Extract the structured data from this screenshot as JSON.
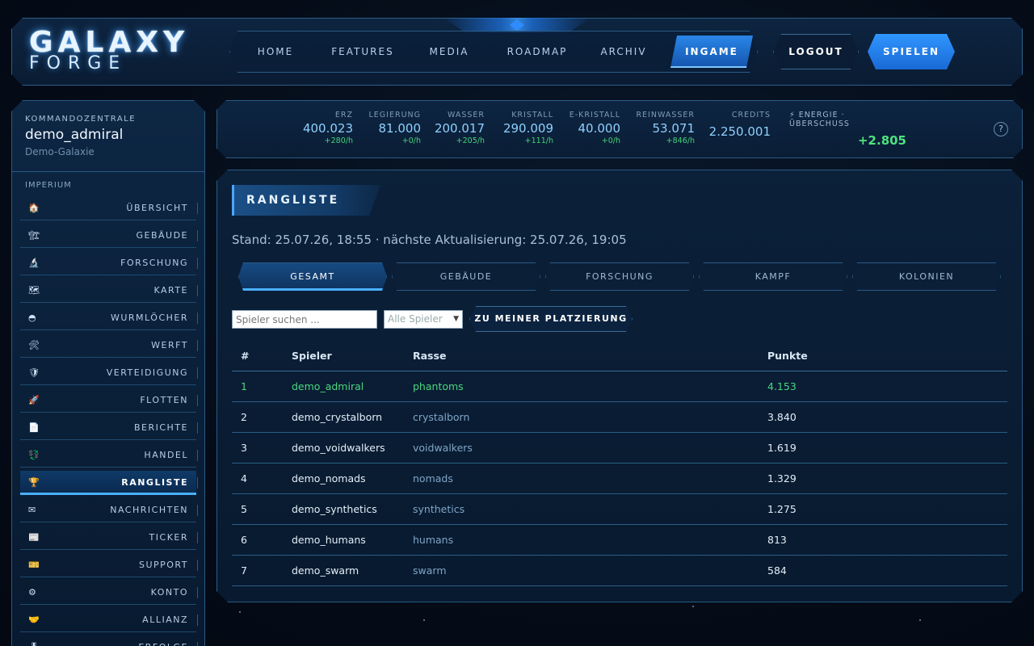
{
  "header": {
    "logo_main": "GALAXY",
    "logo_sub": "FORGE",
    "nav": [
      "HOME",
      "FEATURES",
      "MEDIA",
      "ROADMAP",
      "ARCHIV",
      "INGAME"
    ],
    "active_nav": "INGAME",
    "logout_label": "LOGOUT",
    "play_label": "SPIELEN"
  },
  "sidebar": {
    "kicker": "KOMMANDOZENTRALE",
    "username": "demo_admiral",
    "galaxy": "Demo-Galaxie",
    "section_label": "IMPERIUM",
    "items": [
      {
        "icon": "🏠",
        "label": "ÜBERSICHT"
      },
      {
        "icon": "🏗",
        "label": "GEBÄUDE"
      },
      {
        "icon": "🔬",
        "label": "FORSCHUNG"
      },
      {
        "icon": "🗺",
        "label": "KARTE"
      },
      {
        "icon": "◓",
        "label": "WURMLÖCHER"
      },
      {
        "icon": "🛠",
        "label": "WERFT"
      },
      {
        "icon": "🛡",
        "label": "VERTEIDIGUNG"
      },
      {
        "icon": "🚀",
        "label": "FLOTTEN"
      },
      {
        "icon": "📄",
        "label": "BERICHTE"
      },
      {
        "icon": "💱",
        "label": "HANDEL"
      },
      {
        "icon": "🏆",
        "label": "RANGLISTE"
      },
      {
        "icon": "✉",
        "label": "NACHRICHTEN"
      },
      {
        "icon": "📰",
        "label": "TICKER"
      },
      {
        "icon": "🎫",
        "label": "SUPPORT"
      },
      {
        "icon": "⚙",
        "label": "KONTO"
      },
      {
        "icon": "🤝",
        "label": "ALLIANZ"
      },
      {
        "icon": "🎖",
        "label": "ERFOLGE"
      }
    ],
    "active_item": "RANGLISTE"
  },
  "resources": [
    {
      "label": "ERZ",
      "value": "400.023",
      "rate": "+280/h"
    },
    {
      "label": "LEGIERUNG",
      "value": "81.000",
      "rate": "+0/h"
    },
    {
      "label": "WASSER",
      "value": "200.017",
      "rate": "+205/h"
    },
    {
      "label": "KRISTALL",
      "value": "290.009",
      "rate": "+111/h"
    },
    {
      "label": "E-KRISTALL",
      "value": "40.000",
      "rate": "+0/h"
    },
    {
      "label": "REINWASSER",
      "value": "53.071",
      "rate": "+846/h"
    },
    {
      "label": "CREDITS",
      "value": "2.250.001",
      "rate": ""
    }
  ],
  "energy": {
    "label": "⚡ ENERGIE · ÜBERSCHUSS",
    "value": "+2.805"
  },
  "help_label": "?",
  "main": {
    "title": "RANGLISTE",
    "stand": "Stand: 25.07.26, 18:55 · nächste Aktualisierung: 25.07.26, 19:05",
    "tabs": [
      "GESAMT",
      "GEBÄUDE",
      "FORSCHUNG",
      "KAMPF",
      "KOLONIEN"
    ],
    "active_tab": "GESAMT",
    "search_placeholder": "Spieler suchen ...",
    "filter_value": "Alle Spieler",
    "rank_button": "ZU MEINER PLATZIERUNG",
    "columns": [
      "#",
      "Spieler",
      "Rasse",
      "Punkte"
    ],
    "rows": [
      {
        "rank": "1",
        "player": "demo_admiral",
        "race": "phantoms",
        "points": "4.153",
        "me": true
      },
      {
        "rank": "2",
        "player": "demo_crystalborn",
        "race": "crystalborn",
        "points": "3.840"
      },
      {
        "rank": "3",
        "player": "demo_voidwalkers",
        "race": "voidwalkers",
        "points": "1.619"
      },
      {
        "rank": "4",
        "player": "demo_nomads",
        "race": "nomads",
        "points": "1.329"
      },
      {
        "rank": "5",
        "player": "demo_synthetics",
        "race": "synthetics",
        "points": "1.275"
      },
      {
        "rank": "6",
        "player": "demo_humans",
        "race": "humans",
        "points": "813"
      },
      {
        "rank": "7",
        "player": "demo_swarm",
        "race": "swarm",
        "points": "584"
      }
    ]
  },
  "colors": {
    "accent": "#2a86e8",
    "positive": "#4bd67f",
    "resource": "#8fd0ff"
  }
}
